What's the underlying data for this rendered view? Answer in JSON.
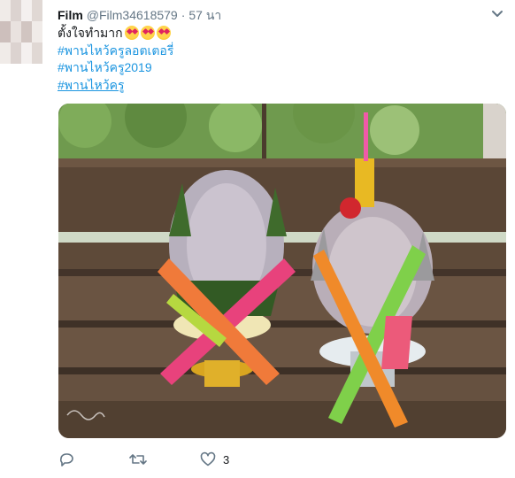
{
  "tweet": {
    "author_name": "Film",
    "author_handle": "@Film34618579",
    "separator": "·",
    "time": "57 นา",
    "text_line1": "ตั้งใจทำมาก",
    "hashtags": [
      "#พานไหว้ครูลอตเตอรี่",
      "#พานไหว้ครู2019",
      "#พานไหว้ครู"
    ],
    "like_count": "3"
  },
  "icons": {
    "menu": "chevron-down-icon",
    "emoji": "heart-eyes-emoji",
    "reply": "reply-icon",
    "retweet": "retweet-icon",
    "like": "heart-icon"
  },
  "colors": {
    "link": "#1b95e0",
    "secondary_text": "#657786",
    "primary_text": "#14171a"
  }
}
